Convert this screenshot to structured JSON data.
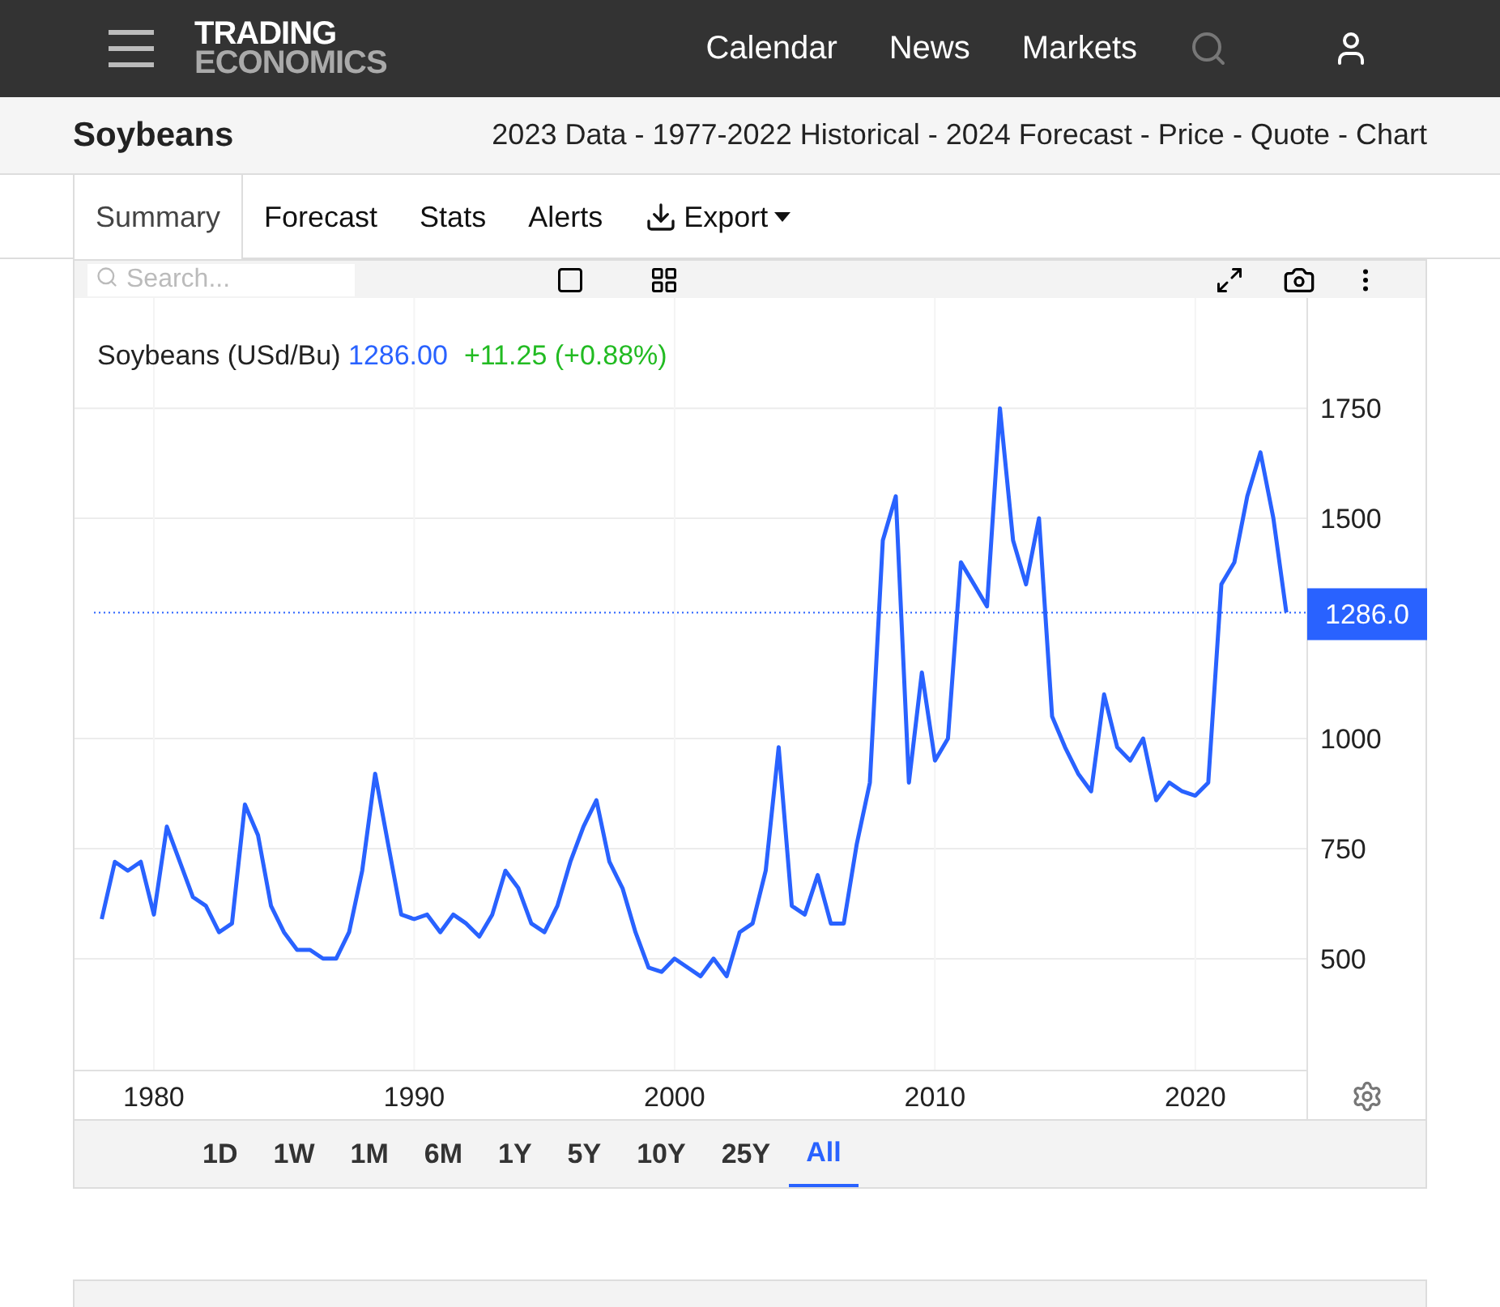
{
  "header": {
    "logo_top": "TRADING",
    "logo_bottom": "ECONOMICS",
    "nav": [
      "Calendar",
      "News",
      "Markets"
    ]
  },
  "title_bar": {
    "title": "Soybeans",
    "separator": "-",
    "links": [
      "2023 Data",
      "1977-2022 Historical",
      "2024 Forecast",
      "Price",
      "Quote",
      "Chart"
    ]
  },
  "tabs": [
    {
      "label": "Summary",
      "selected": true,
      "kind": "plain"
    },
    {
      "label": "Forecast",
      "selected": false,
      "kind": "plain"
    },
    {
      "label": "Stats",
      "selected": false,
      "kind": "plain"
    },
    {
      "label": "Alerts",
      "selected": false,
      "kind": "plain"
    },
    {
      "label": "Export",
      "selected": false,
      "kind": "dropdown"
    }
  ],
  "chart_toolbar": {
    "search": {
      "placeholder": "Search..."
    }
  },
  "chart": {
    "symbol": "Soybeans (USd/Bu)",
    "price": "1286.00",
    "change": "+11.25 (+0.88%)",
    "x_labels": [
      "1980",
      "1990",
      "2000",
      "2010",
      "2020"
    ],
    "chart_data": {
      "type": "line",
      "xlim": [
        1977.7,
        2024.3
      ],
      "ylim": [
        246,
        1993
      ],
      "xticks": [
        1980,
        1990,
        2000,
        2010,
        2020
      ],
      "yticks": [
        500,
        750,
        1000,
        1500,
        1750
      ],
      "x": [
        1978,
        1978.5,
        1979,
        1979.5,
        1980,
        1980.5,
        1981,
        1981.5,
        1982,
        1982.5,
        1983,
        1983.5,
        1984,
        1984.5,
        1985,
        1985.5,
        1986,
        1986.5,
        1987,
        1987.5,
        1988,
        1988.5,
        1989,
        1989.5,
        1990,
        1990.5,
        1991,
        1991.5,
        1992,
        1992.5,
        1993,
        1993.5,
        1994,
        1994.5,
        1995,
        1995.5,
        1996,
        1996.5,
        1997,
        1997.5,
        1998,
        1998.5,
        1999,
        1999.5,
        2000,
        2000.5,
        2001,
        2001.5,
        2002,
        2002.5,
        2003,
        2003.5,
        2004,
        2004.5,
        2005,
        2005.5,
        2006,
        2006.5,
        2007,
        2007.5,
        2008,
        2008.5,
        2009,
        2009.5,
        2010,
        2010.5,
        2011,
        2011.5,
        2012,
        2012.5,
        2013,
        2013.5,
        2014,
        2014.5,
        2015,
        2015.5,
        2016,
        2016.5,
        2017,
        2017.5,
        2018,
        2018.5,
        2019,
        2019.5,
        2020,
        2020.5,
        2021,
        2021.5,
        2022,
        2022.5,
        2023,
        2023.5
      ],
      "grid": true,
      "ref_lines": [
        {
          "value": 1286,
          "label": "1286.0",
          "axis": "y",
          "color": "#2962ff"
        }
      ],
      "series": [
        {
          "color": "#2962ff",
          "values": [
            590,
            720,
            700,
            720,
            600,
            800,
            720,
            640,
            620,
            560,
            580,
            850,
            780,
            620,
            560,
            520,
            520,
            500,
            500,
            560,
            700,
            920,
            760,
            600,
            590,
            600,
            560,
            600,
            580,
            550,
            600,
            700,
            660,
            580,
            560,
            620,
            720,
            800,
            860,
            720,
            660,
            560,
            480,
            470,
            500,
            480,
            460,
            500,
            460,
            560,
            580,
            700,
            980,
            620,
            600,
            690,
            580,
            580,
            760,
            900,
            1450,
            1550,
            900,
            1150,
            950,
            1000,
            1400,
            1350,
            1300,
            1750,
            1450,
            1350,
            1500,
            1050,
            980,
            920,
            880,
            1100,
            980,
            950,
            1000,
            860,
            900,
            880,
            870,
            900,
            1350,
            1400,
            1550,
            1650,
            1500,
            1286
          ]
        }
      ]
    }
  },
  "ranges": [
    {
      "label": "1D",
      "selected": false
    },
    {
      "label": "1W",
      "selected": false
    },
    {
      "label": "1M",
      "selected": false
    },
    {
      "label": "6M",
      "selected": false
    },
    {
      "label": "1Y",
      "selected": false
    },
    {
      "label": "5Y",
      "selected": false
    },
    {
      "label": "10Y",
      "selected": false
    },
    {
      "label": "25Y",
      "selected": false
    },
    {
      "label": "All",
      "selected": true
    }
  ]
}
